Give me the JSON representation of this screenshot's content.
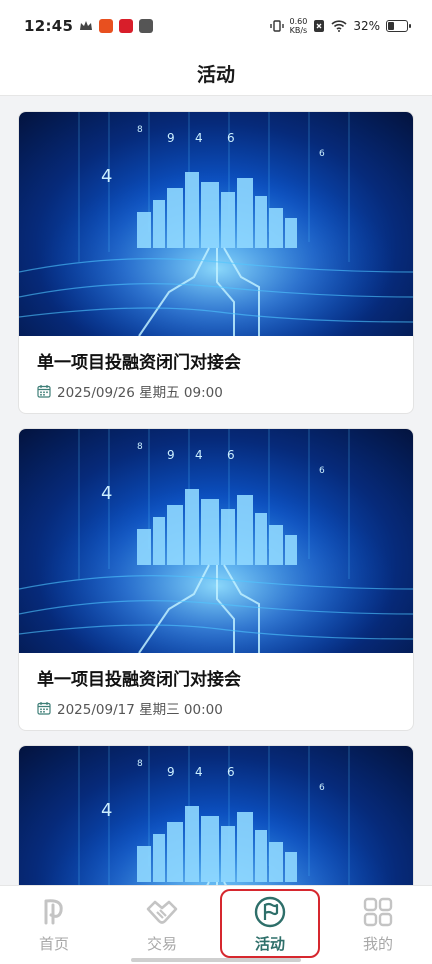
{
  "status_bar": {
    "time": "12:45",
    "speed_value": "0.60",
    "speed_unit": "KB/s",
    "battery": "32%",
    "icons": [
      "crown-icon",
      "app-notif-icon",
      "app-notif-icon",
      "app-notif-icon",
      "vibrate-icon",
      "wifi-icon",
      "sim-icon",
      "battery-icon"
    ]
  },
  "header": {
    "title": "活动"
  },
  "events": [
    {
      "title": "单一项目投融资闭门对接会",
      "datetime": "2025/09/26 星期五 09:00"
    },
    {
      "title": "单一项目投融资闭门对接会",
      "datetime": "2025/09/17 星期三 00:00"
    },
    {
      "title": "",
      "datetime": ""
    }
  ],
  "banner": {
    "digits": [
      "4",
      "9",
      "4",
      "6",
      "8",
      "6"
    ]
  },
  "tabs": [
    {
      "label": "首页",
      "icon": "home-logo-icon",
      "active": false
    },
    {
      "label": "交易",
      "icon": "handshake-icon",
      "active": false
    },
    {
      "label": "活动",
      "icon": "flag-icon",
      "active": true
    },
    {
      "label": "我的",
      "icon": "grid-icon",
      "active": false
    }
  ],
  "colors": {
    "active_tab": "#2e6f6a",
    "inactive_tab": "#a8a8a8",
    "highlight_box": "#d6272e",
    "banner_blue": "#0b4fbf"
  }
}
